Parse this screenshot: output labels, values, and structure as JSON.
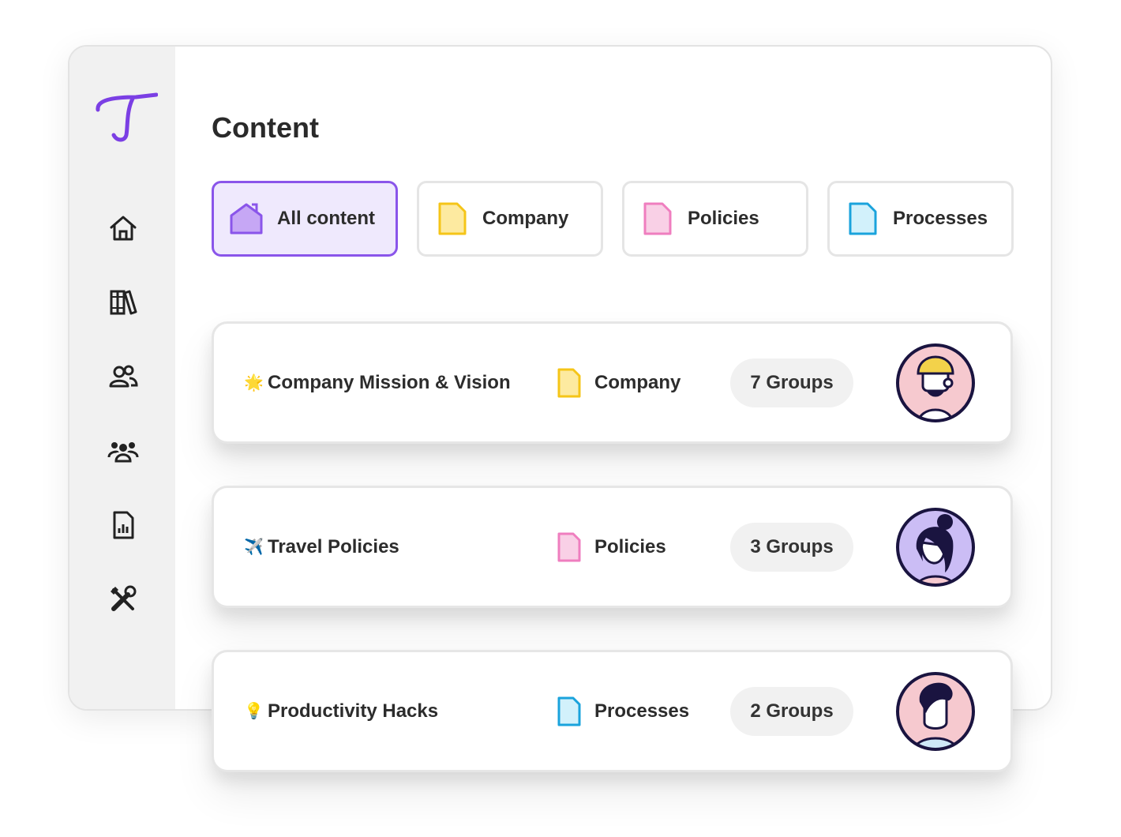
{
  "page_title": "Content",
  "sidebar": {
    "nav": [
      {
        "icon": "home-icon"
      },
      {
        "icon": "library-icon"
      },
      {
        "icon": "users-icon"
      },
      {
        "icon": "groups-icon"
      },
      {
        "icon": "report-icon"
      },
      {
        "icon": "tools-icon"
      }
    ]
  },
  "tabs": [
    {
      "label": "All content",
      "icon": "home-icon",
      "active": true
    },
    {
      "label": "Company",
      "icon": "document-icon"
    },
    {
      "label": "Policies",
      "icon": "document-icon"
    },
    {
      "label": "Processes",
      "icon": "document-icon"
    }
  ],
  "rows": [
    {
      "emoji": "🌟",
      "title": "Company Mission & Vision",
      "category": "Company",
      "groups": "7 Groups",
      "avatar": "avatar-bearded-man"
    },
    {
      "emoji": "✈️",
      "title": "Travel Policies",
      "category": "Policies",
      "groups": "3 Groups",
      "avatar": "avatar-woman-bun"
    },
    {
      "emoji": "💡",
      "title": "Productivity Hacks",
      "category": "Processes",
      "groups": "2 Groups",
      "avatar": "avatar-man"
    }
  ],
  "colors": {
    "brand_purple": "#7b3fe4",
    "company_yellow": "#f5c518",
    "policies_pink": "#ef7ebf",
    "processes_blue": "#1aa3dc",
    "active_tab_bg": "#efe9fd"
  }
}
